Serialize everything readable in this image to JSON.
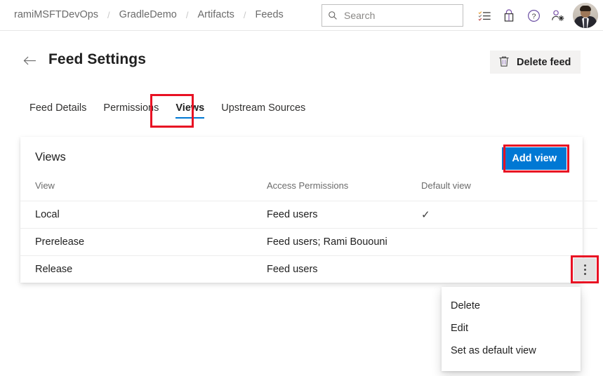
{
  "topbar": {
    "breadcrumb": [
      {
        "label": "ramiMSFTDevOps"
      },
      {
        "label": "GradleDemo"
      },
      {
        "label": "Artifacts"
      },
      {
        "label": "Feeds"
      }
    ],
    "separator": "/",
    "search": {
      "placeholder": "Search",
      "value": "",
      "icon": "search-icon"
    },
    "icons": [
      {
        "name": "tasks-checklist-icon"
      },
      {
        "name": "marketplace-bag-icon"
      },
      {
        "name": "help-question-icon"
      },
      {
        "name": "user-settings-icon"
      }
    ],
    "avatar_alt": "Rami Bououni"
  },
  "page": {
    "back_icon": "back-arrow-icon",
    "title": "Feed Settings",
    "delete_feed": {
      "label": "Delete feed",
      "icon": "trash-icon"
    }
  },
  "tabs": [
    {
      "label": "Feed Details",
      "selected": false
    },
    {
      "label": "Permissions",
      "selected": false
    },
    {
      "label": "Views",
      "selected": true
    },
    {
      "label": "Upstream Sources",
      "selected": false
    }
  ],
  "card": {
    "title": "Views",
    "add_view_label": "Add view",
    "columns": [
      "View",
      "Access Permissions",
      "Default view",
      ""
    ],
    "rows": [
      {
        "view": "Local",
        "access": "Feed users",
        "default": "✓",
        "is_default": true
      },
      {
        "view": "Prerelease",
        "access": "Feed users; Rami Bououni",
        "default": "",
        "is_default": false
      },
      {
        "view": "Release",
        "access": "Feed users",
        "default": "",
        "is_default": false
      }
    ]
  },
  "context_menu": {
    "items": [
      {
        "label": "Delete"
      },
      {
        "label": "Edit"
      },
      {
        "label": "Set as default view"
      }
    ]
  },
  "colors": {
    "accent_blue": "#0078d4",
    "annotation_red": "#e81123",
    "text_primary": "#1f1f1f",
    "text_secondary": "#6b6b6b",
    "button_neutral_bg": "#f3f2f1",
    "row_divider": "#ededed"
  }
}
